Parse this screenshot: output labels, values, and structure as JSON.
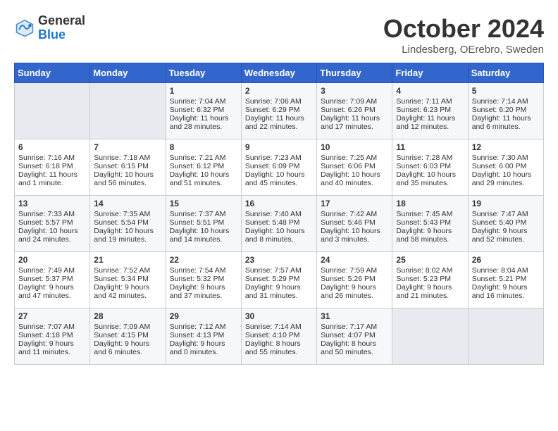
{
  "header": {
    "logo_general": "General",
    "logo_blue": "Blue",
    "month": "October 2024",
    "location": "Lindesberg, OErebro, Sweden"
  },
  "days_of_week": [
    "Sunday",
    "Monday",
    "Tuesday",
    "Wednesday",
    "Thursday",
    "Friday",
    "Saturday"
  ],
  "weeks": [
    [
      {
        "day": "",
        "sunrise": "",
        "sunset": "",
        "daylight": "",
        "empty": true
      },
      {
        "day": "",
        "sunrise": "",
        "sunset": "",
        "daylight": "",
        "empty": true
      },
      {
        "day": "1",
        "sunrise": "Sunrise: 7:04 AM",
        "sunset": "Sunset: 6:32 PM",
        "daylight": "Daylight: 11 hours and 28 minutes."
      },
      {
        "day": "2",
        "sunrise": "Sunrise: 7:06 AM",
        "sunset": "Sunset: 6:29 PM",
        "daylight": "Daylight: 11 hours and 22 minutes."
      },
      {
        "day": "3",
        "sunrise": "Sunrise: 7:09 AM",
        "sunset": "Sunset: 6:26 PM",
        "daylight": "Daylight: 11 hours and 17 minutes."
      },
      {
        "day": "4",
        "sunrise": "Sunrise: 7:11 AM",
        "sunset": "Sunset: 6:23 PM",
        "daylight": "Daylight: 11 hours and 12 minutes."
      },
      {
        "day": "5",
        "sunrise": "Sunrise: 7:14 AM",
        "sunset": "Sunset: 6:20 PM",
        "daylight": "Daylight: 11 hours and 6 minutes."
      }
    ],
    [
      {
        "day": "6",
        "sunrise": "Sunrise: 7:16 AM",
        "sunset": "Sunset: 6:18 PM",
        "daylight": "Daylight: 11 hours and 1 minute."
      },
      {
        "day": "7",
        "sunrise": "Sunrise: 7:18 AM",
        "sunset": "Sunset: 6:15 PM",
        "daylight": "Daylight: 10 hours and 56 minutes."
      },
      {
        "day": "8",
        "sunrise": "Sunrise: 7:21 AM",
        "sunset": "Sunset: 6:12 PM",
        "daylight": "Daylight: 10 hours and 51 minutes."
      },
      {
        "day": "9",
        "sunrise": "Sunrise: 7:23 AM",
        "sunset": "Sunset: 6:09 PM",
        "daylight": "Daylight: 10 hours and 45 minutes."
      },
      {
        "day": "10",
        "sunrise": "Sunrise: 7:25 AM",
        "sunset": "Sunset: 6:06 PM",
        "daylight": "Daylight: 10 hours and 40 minutes."
      },
      {
        "day": "11",
        "sunrise": "Sunrise: 7:28 AM",
        "sunset": "Sunset: 6:03 PM",
        "daylight": "Daylight: 10 hours and 35 minutes."
      },
      {
        "day": "12",
        "sunrise": "Sunrise: 7:30 AM",
        "sunset": "Sunset: 6:00 PM",
        "daylight": "Daylight: 10 hours and 29 minutes."
      }
    ],
    [
      {
        "day": "13",
        "sunrise": "Sunrise: 7:33 AM",
        "sunset": "Sunset: 5:57 PM",
        "daylight": "Daylight: 10 hours and 24 minutes."
      },
      {
        "day": "14",
        "sunrise": "Sunrise: 7:35 AM",
        "sunset": "Sunset: 5:54 PM",
        "daylight": "Daylight: 10 hours and 19 minutes."
      },
      {
        "day": "15",
        "sunrise": "Sunrise: 7:37 AM",
        "sunset": "Sunset: 5:51 PM",
        "daylight": "Daylight: 10 hours and 14 minutes."
      },
      {
        "day": "16",
        "sunrise": "Sunrise: 7:40 AM",
        "sunset": "Sunset: 5:48 PM",
        "daylight": "Daylight: 10 hours and 8 minutes."
      },
      {
        "day": "17",
        "sunrise": "Sunrise: 7:42 AM",
        "sunset": "Sunset: 5:46 PM",
        "daylight": "Daylight: 10 hours and 3 minutes."
      },
      {
        "day": "18",
        "sunrise": "Sunrise: 7:45 AM",
        "sunset": "Sunset: 5:43 PM",
        "daylight": "Daylight: 9 hours and 58 minutes."
      },
      {
        "day": "19",
        "sunrise": "Sunrise: 7:47 AM",
        "sunset": "Sunset: 5:40 PM",
        "daylight": "Daylight: 9 hours and 52 minutes."
      }
    ],
    [
      {
        "day": "20",
        "sunrise": "Sunrise: 7:49 AM",
        "sunset": "Sunset: 5:37 PM",
        "daylight": "Daylight: 9 hours and 47 minutes."
      },
      {
        "day": "21",
        "sunrise": "Sunrise: 7:52 AM",
        "sunset": "Sunset: 5:34 PM",
        "daylight": "Daylight: 9 hours and 42 minutes."
      },
      {
        "day": "22",
        "sunrise": "Sunrise: 7:54 AM",
        "sunset": "Sunset: 5:32 PM",
        "daylight": "Daylight: 9 hours and 37 minutes."
      },
      {
        "day": "23",
        "sunrise": "Sunrise: 7:57 AM",
        "sunset": "Sunset: 5:29 PM",
        "daylight": "Daylight: 9 hours and 31 minutes."
      },
      {
        "day": "24",
        "sunrise": "Sunrise: 7:59 AM",
        "sunset": "Sunset: 5:26 PM",
        "daylight": "Daylight: 9 hours and 26 minutes."
      },
      {
        "day": "25",
        "sunrise": "Sunrise: 8:02 AM",
        "sunset": "Sunset: 5:23 PM",
        "daylight": "Daylight: 9 hours and 21 minutes."
      },
      {
        "day": "26",
        "sunrise": "Sunrise: 8:04 AM",
        "sunset": "Sunset: 5:21 PM",
        "daylight": "Daylight: 9 hours and 16 minutes."
      }
    ],
    [
      {
        "day": "27",
        "sunrise": "Sunrise: 7:07 AM",
        "sunset": "Sunset: 4:18 PM",
        "daylight": "Daylight: 9 hours and 11 minutes."
      },
      {
        "day": "28",
        "sunrise": "Sunrise: 7:09 AM",
        "sunset": "Sunset: 4:15 PM",
        "daylight": "Daylight: 9 hours and 6 minutes."
      },
      {
        "day": "29",
        "sunrise": "Sunrise: 7:12 AM",
        "sunset": "Sunset: 4:13 PM",
        "daylight": "Daylight: 9 hours and 0 minutes."
      },
      {
        "day": "30",
        "sunrise": "Sunrise: 7:14 AM",
        "sunset": "Sunset: 4:10 PM",
        "daylight": "Daylight: 8 hours and 55 minutes."
      },
      {
        "day": "31",
        "sunrise": "Sunrise: 7:17 AM",
        "sunset": "Sunset: 4:07 PM",
        "daylight": "Daylight: 8 hours and 50 minutes."
      },
      {
        "day": "",
        "sunrise": "",
        "sunset": "",
        "daylight": "",
        "empty": true
      },
      {
        "day": "",
        "sunrise": "",
        "sunset": "",
        "daylight": "",
        "empty": true
      }
    ]
  ]
}
